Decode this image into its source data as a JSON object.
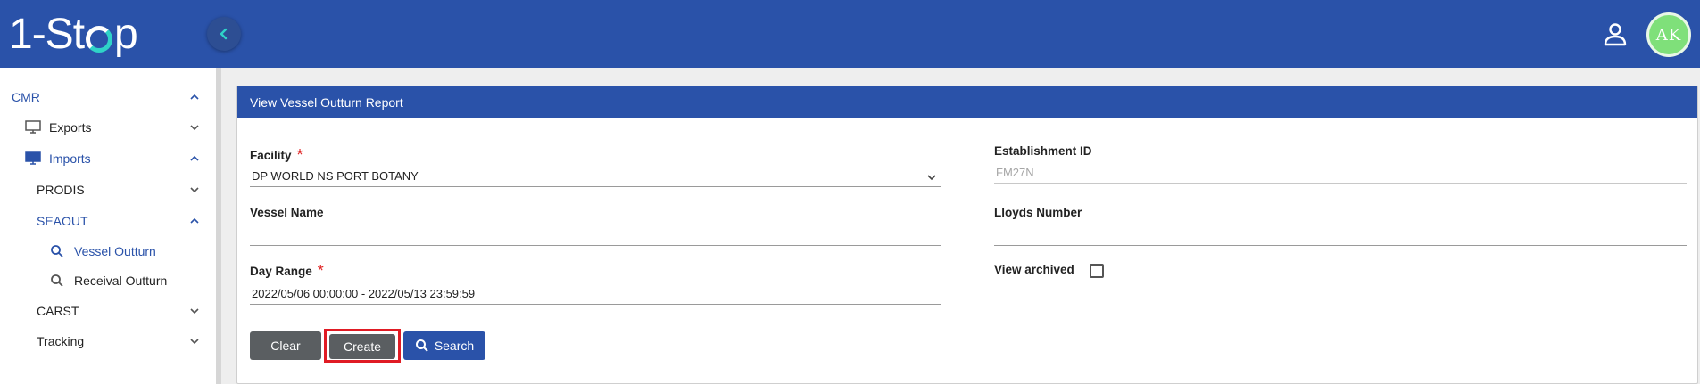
{
  "app": {
    "logo_text_left": "1-St",
    "logo_text_right": "p",
    "avatar_initials": "AK"
  },
  "colors": {
    "brand_blue": "#2a52a9",
    "accent_teal": "#2fd3c8",
    "avatar_green": "#7fe07a",
    "required_red": "#e02424",
    "button_gray": "#5a5e61",
    "highlight_red": "#e01b24"
  },
  "sidebar": {
    "cmr": "CMR",
    "exports": "Exports",
    "imports": "Imports",
    "prodis": "PRODIS",
    "seaout": "SEAOUT",
    "vessel_outturn": "Vessel Outturn",
    "receival_outturn": "Receival Outturn",
    "carst": "CARST",
    "tracking": "Tracking"
  },
  "panel": {
    "title": "View Vessel Outturn Report"
  },
  "form": {
    "facility_label": "Facility",
    "facility_value": "DP WORLD NS PORT BOTANY",
    "required_mark": "*",
    "vessel_name_label": "Vessel Name",
    "vessel_name_value": "",
    "day_range_label": "Day Range",
    "day_range_value": "2022/05/06 00:00:00 - 2022/05/13 23:59:59",
    "establishment_id_label": "Establishment ID",
    "establishment_id_value": "FM27N",
    "lloyds_number_label": "Lloyds Number",
    "lloyds_number_value": "",
    "view_archived_label": "View archived",
    "view_archived_checked": false
  },
  "buttons": {
    "clear": "Clear",
    "create": "Create",
    "search": "Search"
  }
}
